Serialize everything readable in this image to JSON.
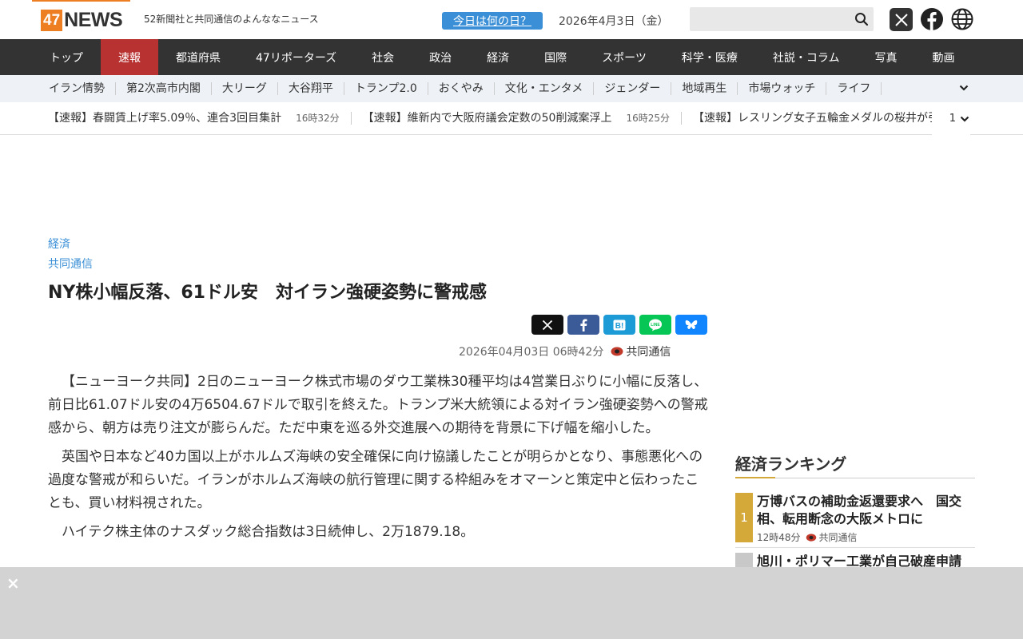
{
  "header": {
    "logo_num": "47",
    "logo_word": "NEWS",
    "tagline": "52新聞社と共同通信のよんななニュース",
    "today_button": "今日は何の日？",
    "date": "2026年4月3日（金）",
    "search_placeholder": ""
  },
  "main_nav": [
    {
      "label": "トップ"
    },
    {
      "label": "速報",
      "active": true
    },
    {
      "label": "都道府県"
    },
    {
      "label": "47リポーターズ"
    },
    {
      "label": "社会"
    },
    {
      "label": "政治"
    },
    {
      "label": "経済"
    },
    {
      "label": "国際"
    },
    {
      "label": "スポーツ"
    },
    {
      "label": "科学・医療"
    },
    {
      "label": "社説・コラム"
    },
    {
      "label": "写真"
    },
    {
      "label": "動画"
    }
  ],
  "sub_nav": [
    {
      "label": "イラン情勢"
    },
    {
      "label": "第2次高市内閣"
    },
    {
      "label": "大リーグ"
    },
    {
      "label": "大谷翔平"
    },
    {
      "label": "トランプ2.0"
    },
    {
      "label": "おくやみ"
    },
    {
      "label": "文化・エンタメ"
    },
    {
      "label": "ジェンダー"
    },
    {
      "label": "地域再生"
    },
    {
      "label": "市場ウォッチ"
    },
    {
      "label": "ライフ"
    }
  ],
  "ticker": {
    "items": [
      {
        "title": "【速報】春闘賃上げ率5.09％、連合3回目集計",
        "time": "16時32分"
      },
      {
        "title": "【速報】維新内で大阪府議会定数の50削減案浮上",
        "time": "16時25分"
      },
      {
        "title": "【速報】レスリング女子五輪金メダルの桜井が引退",
        "time": ""
      }
    ],
    "count": "1"
  },
  "article": {
    "category": "経済",
    "source_link": "共同通信",
    "headline": "NY株小幅反落、61ドル安　対イラン強硬姿勢に警戒感",
    "published": "2026年04月03日 06時42分",
    "source": "共同通信",
    "paragraphs": [
      "【ニューヨーク共同】2日のニューヨーク株式市場のダウ工業株30種平均は4営業日ぶりに小幅に反落し、前日比61.07ドル安の4万6504.67ドルで取引を終えた。トランプ米大統領による対イラン強硬姿勢への警戒感から、朝方は売り注文が膨らんだ。ただ中東を巡る外交進展への期待を背景に下げ幅を縮小した。",
      "英国や日本など40カ国以上がホルムズ海峡の安全確保に向け協議したことが明らかとなり、事態悪化への過度な警戒が和らいだ。イランがホルムズ海峡の航行管理に関する枠組みをオマーンと策定中と伝わったことも、買い材料視された。",
      "ハイテク株主体のナスダック総合指数は3日続伸し、2万1879.18。"
    ]
  },
  "ranking": {
    "title": "経済ランキング",
    "items": [
      {
        "rank": "1",
        "headline": "万博バスの補助金返還要求へ　国交相、転用断念の大阪メトロに",
        "time": "12時48分",
        "source": "共同通信",
        "color": "#d4a93a"
      },
      {
        "rank": "",
        "headline": "旭川・ポリマー工業が自己破産申請",
        "color": "#c8c8c8"
      }
    ]
  },
  "ad": {
    "close_label": "×"
  },
  "colors": {
    "brand_orange": "#ee7e22",
    "nav_bg": "#333333",
    "nav_active": "#b83232",
    "link_blue": "#3b8fd6"
  }
}
